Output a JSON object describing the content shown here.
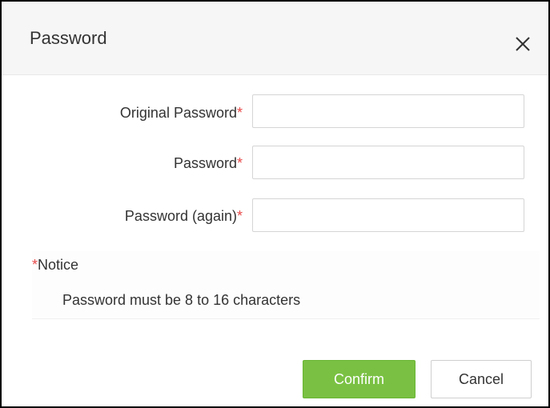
{
  "dialog": {
    "title": "Password",
    "close_icon": "close-icon"
  },
  "form": {
    "required_mark": "*",
    "original_password_label": "Original Password",
    "password_label": "Password",
    "password_again_label": "Password (again)",
    "original_password_value": "",
    "password_value": "",
    "password_again_value": ""
  },
  "notice": {
    "title": "Notice",
    "text": "Password must be 8 to 16 characters"
  },
  "buttons": {
    "confirm_label": "Confirm",
    "cancel_label": "Cancel"
  },
  "colors": {
    "accent": "#7ac143",
    "required": "#e84a4a"
  }
}
